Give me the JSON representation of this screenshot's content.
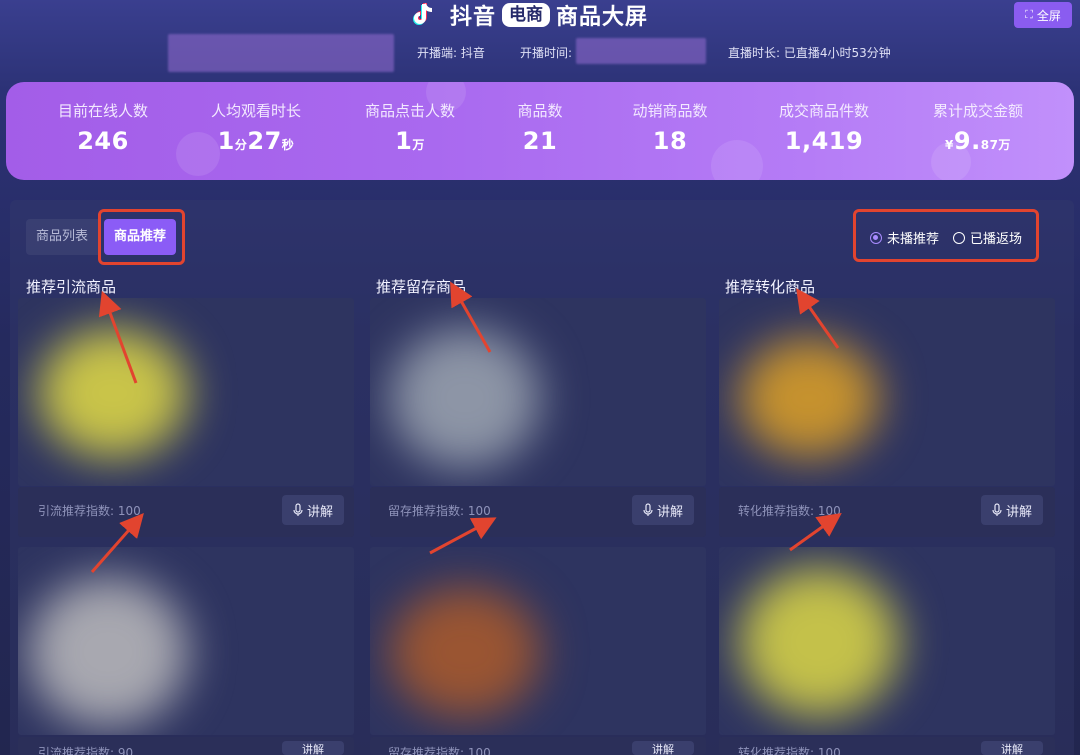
{
  "header": {
    "title_main": "抖音",
    "title_badge": "电商",
    "title_tail": "商品大屏",
    "fullscreen_label": "全屏",
    "platform": "开播端: 抖音",
    "start_time_label": "开播时间:",
    "duration": "直播时长: 已直播4小时53分钟"
  },
  "stats": [
    {
      "label": "目前在线人数",
      "value": "246",
      "unit": ""
    },
    {
      "label": "人均观看时长",
      "value": "1",
      "unit": "分",
      "value2": "27",
      "unit2": "秒"
    },
    {
      "label": "商品点击人数",
      "value": "1",
      "unit": "万"
    },
    {
      "label": "商品数",
      "value": "21",
      "unit": ""
    },
    {
      "label": "动销商品数",
      "value": "18",
      "unit": ""
    },
    {
      "label": "成交商品件数",
      "value": "1,419",
      "unit": ""
    },
    {
      "label": "累计成交金额",
      "prefix": "¥",
      "value": "9.",
      "unit": "87万"
    }
  ],
  "tabs": {
    "list": "商品列表",
    "recommend": "商品推荐"
  },
  "filters": {
    "not_pushed": "未播推荐",
    "returned": "已播返场"
  },
  "sections": [
    {
      "title": "推荐引流商品",
      "index_label": "引流推荐指数: 100",
      "index_label_2": "引流推荐指数: 90"
    },
    {
      "title": "推荐留存商品",
      "index_label": "留存推荐指数: 100",
      "index_label_2": "留存推荐指数: 100"
    },
    {
      "title": "推荐转化商品",
      "index_label": "转化推荐指数: 100",
      "index_label_2": "转化推荐指数: 100"
    }
  ],
  "explain_label": "讲解",
  "colors": {
    "accent": "#8b5cf6",
    "highlight": "#e2442f",
    "banner": "#a969ef"
  }
}
